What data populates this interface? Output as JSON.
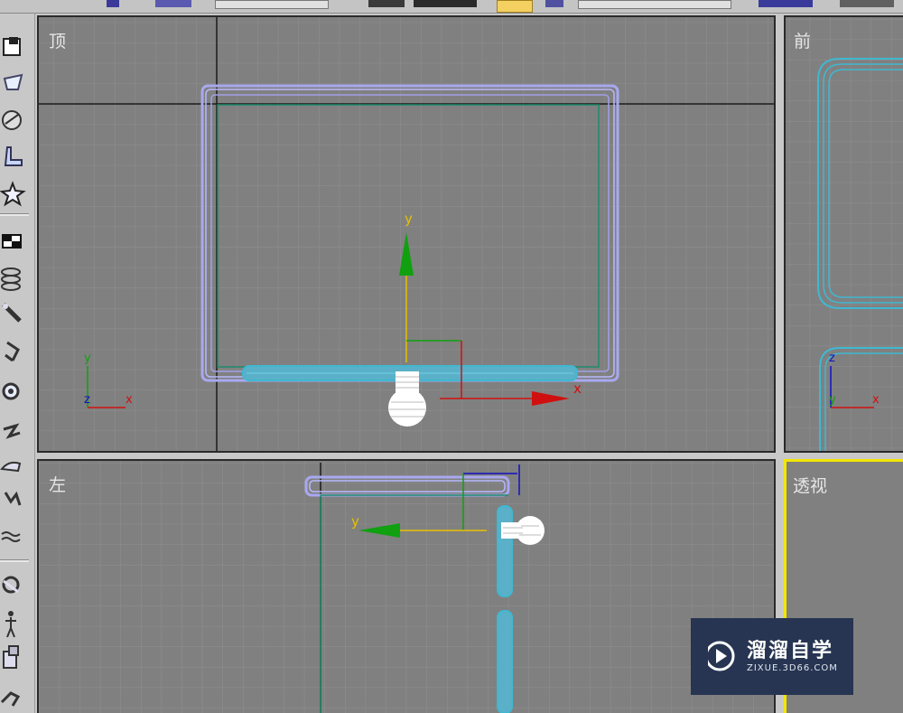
{
  "viewports": {
    "top": {
      "label": "顶"
    },
    "front": {
      "label": "前"
    },
    "left": {
      "label": "左"
    },
    "perspective": {
      "label": "透视"
    }
  },
  "axes": {
    "x": "x",
    "y": "y",
    "z": "z"
  },
  "colors": {
    "viewport_bg": "#808080",
    "grid_line": "#8e8e8e",
    "grid_major": "#6e6e6e",
    "active_border": "#f2e600",
    "inactive_border": "#2a2a2a",
    "purple_object": "#a8a8f0",
    "cyan_object": "#3fb8d0",
    "green_line": "#1f8a6a",
    "axis_x": "#d01010",
    "axis_y": "#e8c000",
    "axis_z": "#1010c0",
    "gizmo_green": "#10a010"
  },
  "watermark": {
    "title": "溜溜自学",
    "subtitle": "ZIXUE.3D66.COM"
  },
  "sidebar_icons": [
    "box-icon",
    "teapot-icon",
    "sphere-icon",
    "boot-icon",
    "star-icon",
    "pattern-icon",
    "rings-icon",
    "wrench-icon",
    "lamp-icon",
    "gear-icon",
    "bolt-icon",
    "cloud-icon",
    "jump-icon",
    "wave-icon",
    "knot-icon",
    "figure-icon",
    "cube-stack-icon",
    "tool-icon"
  ]
}
